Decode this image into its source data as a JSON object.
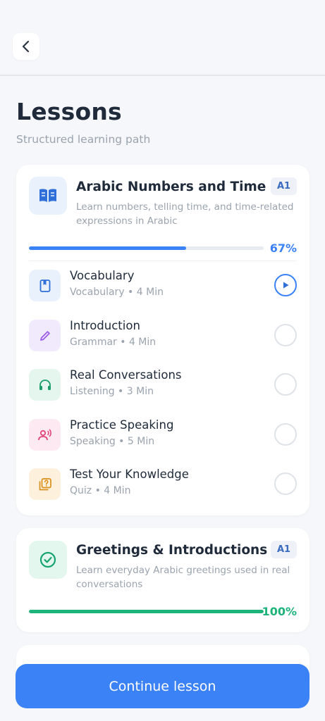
{
  "header": {
    "back_icon": "chevron-left-icon"
  },
  "page": {
    "title": "Lessons",
    "subtitle": "Structured learning path"
  },
  "colors": {
    "accent": "#3b82f6",
    "success": "#1db37a",
    "page_bg": "#f6f7fa",
    "card_bg": "#ffffff"
  },
  "lessons": [
    {
      "title": "Arabic Numbers and Time",
      "level": "A1",
      "description": "Learn numbers, telling time, and time-related expressions in Arabic",
      "icon": "open-book-icon",
      "progress": 0.67,
      "progress_label": "67%",
      "steps": [
        {
          "title": "Vocabulary",
          "meta": "Vocabulary • 4 Min",
          "icon": "book-icon",
          "status": "in-progress"
        },
        {
          "title": "Introduction",
          "meta": "Grammar • 4 Min",
          "icon": "pencil-icon",
          "status": "not-started"
        },
        {
          "title": "Real Conversations",
          "meta": "Listening • 3 Min",
          "icon": "headphones-icon",
          "status": "not-started"
        },
        {
          "title": "Practice Speaking",
          "meta": "Speaking • 5 Min",
          "icon": "speaking-person-icon",
          "status": "not-started"
        },
        {
          "title": "Test Your Knowledge",
          "meta": "Quiz • 4 Min",
          "icon": "quiz-icon",
          "status": "not-started"
        }
      ]
    },
    {
      "title": "Greetings & Introductions",
      "level": "A1",
      "description": "Learn everyday Arabic greetings used in real conversations",
      "icon": "check-circle-icon",
      "progress": 1.0,
      "progress_label": "100%"
    }
  ],
  "cta": {
    "label": "Continue lesson"
  }
}
